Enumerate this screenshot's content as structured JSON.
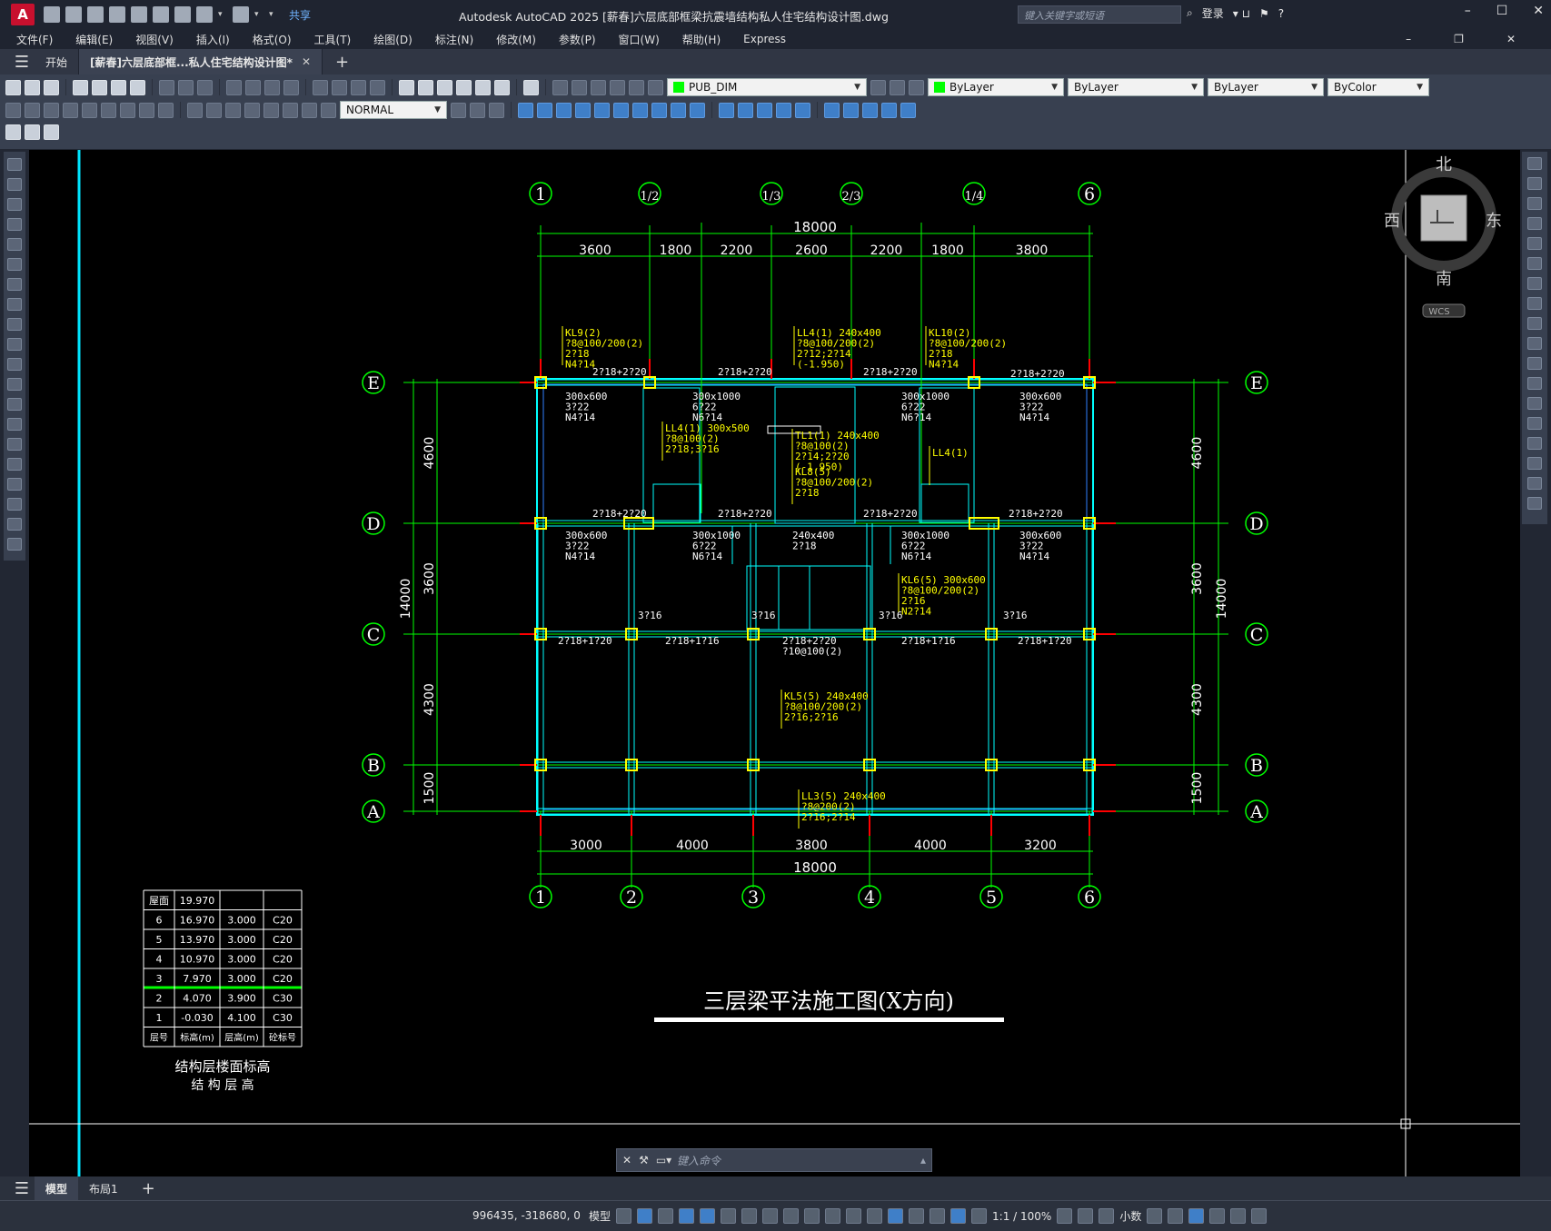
{
  "app": {
    "logo": "A",
    "share_label": "共享",
    "window_title": "Autodesk AutoCAD 2025    [薪春]六层底部框梁抗震墙结构私人住宅结构设计图.dwg",
    "search_placeholder": "键入关键字或短语",
    "login_label": "登录",
    "help_label": "?"
  },
  "menu": [
    "文件(F)",
    "编辑(E)",
    "视图(V)",
    "插入(I)",
    "格式(O)",
    "工具(T)",
    "绘图(D)",
    "标注(N)",
    "修改(M)",
    "参数(P)",
    "窗口(W)",
    "帮助(H)",
    "Express"
  ],
  "tabs": {
    "start": "开始",
    "doc": "[薪春]六层底部框...私人住宅结构设计图*"
  },
  "toolbar": {
    "layer": "PUB_DIM",
    "color": "ByLayer",
    "linetype": "ByLayer",
    "lineweight": "ByLayer",
    "plotstyle": "ByColor",
    "dimstyle": "NORMAL"
  },
  "viewcube": {
    "north": "北",
    "south": "南",
    "east": "东",
    "west": "西",
    "wcs": "WCS"
  },
  "drawing": {
    "top_axes": [
      "1",
      "1/2",
      "1/3",
      "2/3",
      "1/4",
      "6"
    ],
    "bottom_axes": [
      "1",
      "2",
      "3",
      "4",
      "5",
      "6"
    ],
    "row_axes": [
      "E",
      "D",
      "C",
      "B",
      "A"
    ],
    "top_total": "18000",
    "top_dims": [
      "3600",
      "1800",
      "2200",
      "2600",
      "2200",
      "1800",
      "3800"
    ],
    "bottom_dims": [
      "3000",
      "4000",
      "3800",
      "4000",
      "3200"
    ],
    "bottom_total": "18000",
    "left_dims": [
      "4600",
      "3600",
      "4300",
      "1500"
    ],
    "left_total": "14000",
    "right_dims": [
      "4600",
      "3600",
      "4300",
      "1500"
    ],
    "right_total": "14000",
    "beam_notes": [
      {
        "text": "KL9(2)\n?8@100/200(2)\n2?18\nN4?14"
      },
      {
        "text": "LL4(1) 240x400\n?8@100/200(2)\n2?12;2?14\n(-1.950)"
      },
      {
        "text": "KL10(2)\n?8@100/200(2)\n2?18\nN4?14"
      },
      {
        "text": "LL4(1) 300x500\n?8@100(2)\n2?18;3?16"
      },
      {
        "text": "TL1(1) 240x400\n?8@100(2)\n2?14;2?20\n(-1.950)"
      },
      {
        "text": "KL8(5)\n?8@100/200(2)\n2?18"
      },
      {
        "text": "LL4(1)"
      },
      {
        "text": "KL6(5) 300x600\n?8@100/200(2)\n2?16\nN2?14"
      },
      {
        "text": "KL5(5) 240x400\n?8@100/200(2)\n2?16;2?16"
      },
      {
        "text": "LL3(5) 240x400\n?8@200(2)\n2?16;2?14"
      }
    ],
    "rebar_labels": [
      "2?18+2?20",
      "2?18+2?20",
      "2?18+2?20",
      "2?18+2?20",
      "2?18+2?20",
      "2?18+2?20",
      "2?18+2?20",
      "2?18+2?20",
      "3?16",
      "3?16",
      "3?16",
      "3?16",
      "2?18+1?20",
      "2?18+1?16",
      "2?18+2?20\n?10@100(2)",
      "2?18+1?16",
      "2?18+1?20"
    ],
    "section_labels": [
      "300x600\n3?22\nN4?14",
      "300x1000\n6?22\nN6?14",
      "300x1000\n6?22\nN6?14",
      "300x600\n3?22\nN4?14",
      "300x600\n3?22\nN4?14",
      "300x1000\n6?22\nN6?14",
      "240x400\n2?18",
      "300x1000\n6?22\nN6?14",
      "300x600\n3?22\nN4?14"
    ],
    "title": "三层梁平法施工图(X方向)",
    "level_table": {
      "rows": [
        [
          "屋面",
          "19.970",
          "",
          ""
        ],
        [
          "6",
          "16.970",
          "3.000",
          "C20"
        ],
        [
          "5",
          "13.970",
          "3.000",
          "C20"
        ],
        [
          "4",
          "10.970",
          "3.000",
          "C20"
        ],
        [
          "3",
          "7.970",
          "3.000",
          "C20"
        ],
        [
          "2",
          "4.070",
          "3.900",
          "C30"
        ],
        [
          "1",
          "-0.030",
          "4.100",
          "C30"
        ]
      ],
      "footer": [
        "层号",
        "标高(m)",
        "层高(m)",
        "砼标号"
      ],
      "caption": "结构层楼面标高",
      "caption2": "结 构 层 高"
    }
  },
  "command": {
    "placeholder": "键入命令"
  },
  "layouts": [
    "模型",
    "布局1"
  ],
  "status": {
    "coords": "996435, -318680, 0",
    "model": "模型",
    "scale": "1:1 / 100%",
    "units": "小数"
  }
}
